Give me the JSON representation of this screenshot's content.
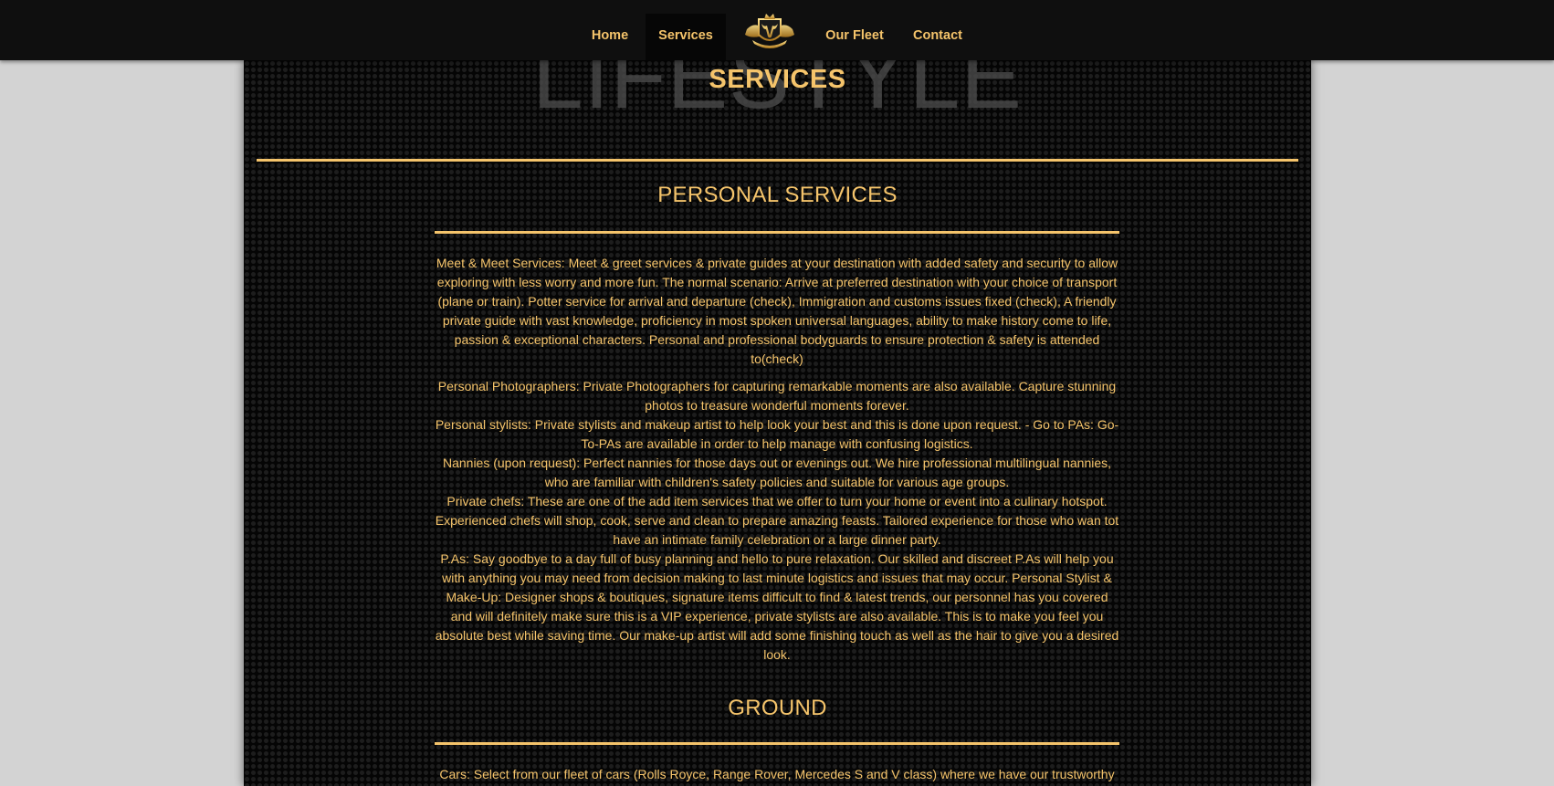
{
  "nav": {
    "items": [
      {
        "label": "Home"
      },
      {
        "label": "Services"
      },
      {
        "label": "Our Fleet"
      },
      {
        "label": "Contact"
      }
    ],
    "active": "Services",
    "logo_icon": "golden-bull-crest-icon"
  },
  "hero": {
    "watermark": "LIFESTYLE",
    "title": "SERVICES"
  },
  "sections": {
    "personal": {
      "title": "PERSONAL SERVICES",
      "paragraphs": [
        "Meet & Meet Services: Meet & greet services & private guides at your destination with added safety and security to allow exploring with less worry and more fun. The normal scenario: Arrive at preferred destination with your choice of transport (plane or train). Potter service for arrival and departure (check), Immigration and customs issues fixed (check), A friendly private guide with vast knowledge, proficiency in most spoken universal languages, ability to make history come to life, passion & exceptional characters. Personal and professional bodyguards to ensure protection & safety is attended to(check)",
        "Personal Photographers: Private Photographers for capturing remarkable moments are also available. Capture stunning photos to treasure wonderful moments forever.",
        "Personal stylists: Private stylists and makeup artist to help look your best and this is done upon request. - Go to PAs: Go-To-PAs are available in order to help manage with confusing logistics.",
        "Nannies (upon request): Perfect nannies for those days out or evenings out. We hire professional multilingual nannies, who are familiar with children's safety policies and suitable for various age groups.",
        "Private chefs: These are one of the add item services that we offer to turn your home or event into a culinary hotspot. Experienced chefs will shop, cook, serve and clean to prepare amazing feasts. Tailored experience for those who wan tot have an intimate family celebration or a large dinner party.",
        "P.As: Say goodbye to a day full of busy planning and hello to pure relaxation. Our skilled and discreet P.As will help you with anything you may need from decision making to last minute logistics and issues that may occur. Personal Stylist & Make-Up: Designer shops & boutiques, signature items difficult to find & latest trends, our personnel has you covered and will definitely make sure this is a VIP experience, private stylists are also available. This is to make you feel you absolute best while saving time. Our make-up artist will add some finishing touch as well as the hair to give you a desired look."
      ]
    },
    "ground": {
      "title": "GROUND",
      "paragraphs": [
        "Cars: Select from our fleet of cars (Rolls Royce, Range Rover, Mercedes S and V class) where we have our trustworthy"
      ]
    }
  },
  "colors": {
    "gold": "#f5c46b",
    "nav_bg": "#0f0f0f",
    "page_bg": "#d3d3d3",
    "panel_bg": "#050505"
  }
}
